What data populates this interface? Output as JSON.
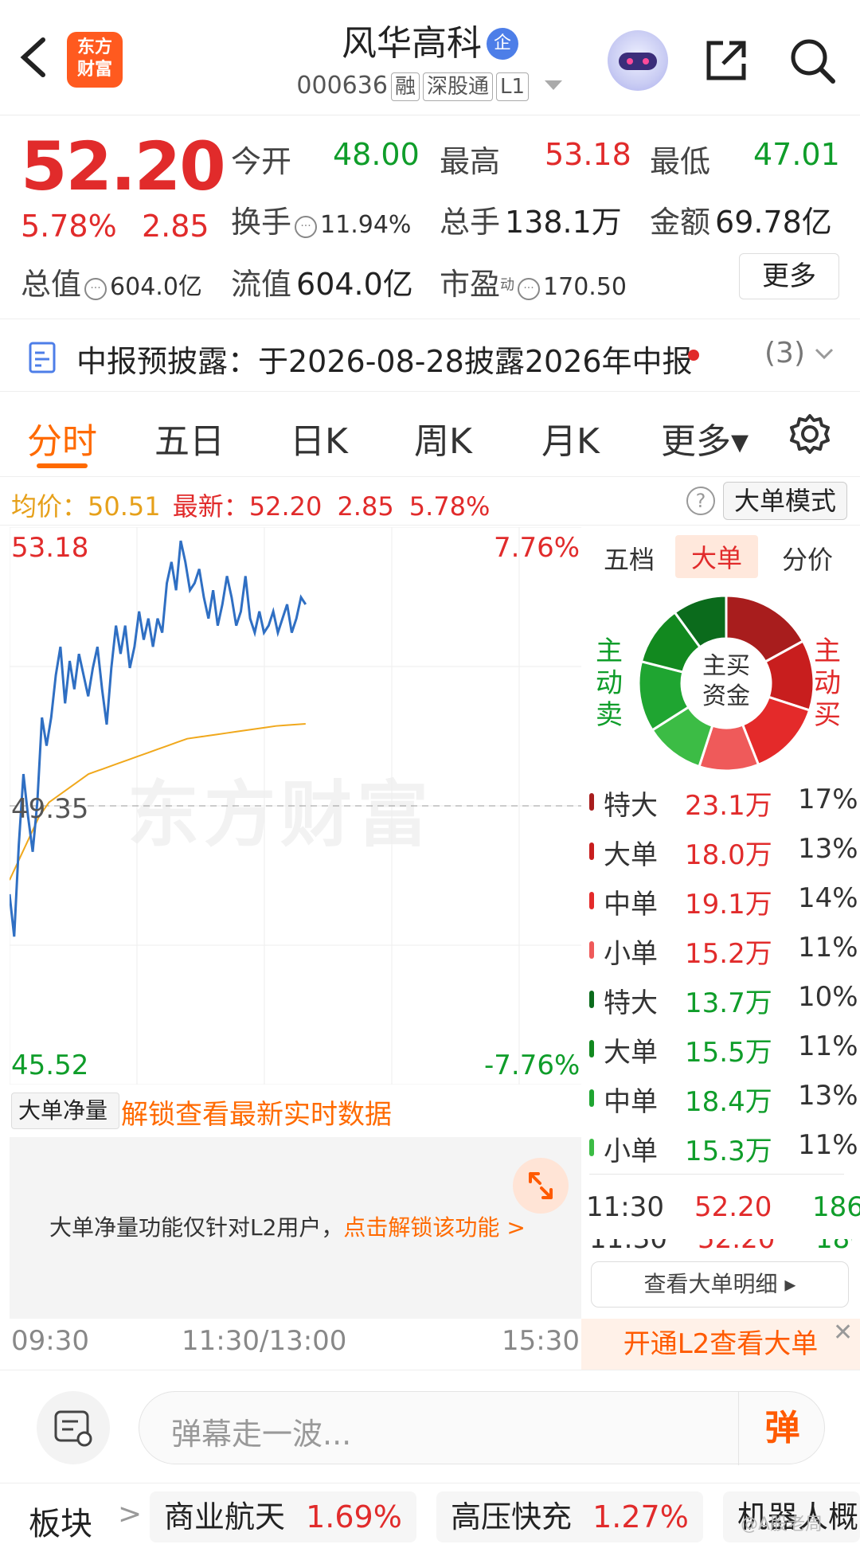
{
  "header": {
    "back_icon": "chevron-left-icon",
    "logo_line1": "东方",
    "logo_line2": "财富",
    "stock_name": "风华高科",
    "badge": "企",
    "code": "000636",
    "tags": [
      "融",
      "深股通",
      "L1"
    ]
  },
  "quote": {
    "price": "52.20",
    "pct": "5.78%",
    "change": "2.85",
    "open_label": "今开",
    "open": "48.00",
    "high_label": "最高",
    "high": "53.18",
    "low_label": "最低",
    "low": "47.01",
    "turnover_label": "换手",
    "turnover": "11.94%",
    "volume_label": "总手",
    "volume": "138.1万",
    "amount_label": "金额",
    "amount": "69.78亿",
    "mktcap_label": "总值",
    "mktcap": "604.0亿",
    "float_label": "流值",
    "float": "604.0亿",
    "pe_label": "市盈",
    "pe_sup": "动",
    "pe": "170.50",
    "more": "更多"
  },
  "disclosure": {
    "text": "中报预披露：于2026-08-28披露2026年中报",
    "count": "(3)"
  },
  "tabs": [
    "分时",
    "五日",
    "日K",
    "周K",
    "月K",
    "更多▾"
  ],
  "avg_row": {
    "avg_label": "均价：",
    "avg": "50.51",
    "latest_label": "最新：",
    "latest": "52.20",
    "chg": "2.85",
    "pct": "5.78%",
    "help": "?",
    "mode_button": "大单模式"
  },
  "chart_data": {
    "type": "line",
    "y_max_label": "53.18",
    "y_mid_label": "49.35",
    "y_min_label": "45.52",
    "pct_max_label": "7.76%",
    "pct_min_label": "-7.76%",
    "x_labels": [
      "09:30",
      "11:30/13:00",
      "15:30"
    ],
    "ylim": [
      45.52,
      53.18
    ],
    "series": [
      {
        "name": "price",
        "values": [
          48.1,
          47.5,
          48.8,
          49.8,
          49.2,
          48.7,
          49.4,
          50.6,
          50.2,
          50.6,
          51.2,
          51.6,
          50.8,
          51.4,
          51.0,
          51.5,
          51.2,
          50.9,
          51.3,
          51.6,
          51.0,
          50.5,
          51.3,
          51.9,
          51.5,
          51.9,
          51.3,
          51.6,
          52.1,
          51.7,
          52.0,
          51.6,
          52.0,
          51.8,
          52.5,
          52.8,
          52.4,
          53.1,
          52.8,
          52.4,
          52.5,
          52.7,
          52.3,
          52.0,
          52.4,
          51.9,
          52.2,
          52.6,
          52.3,
          51.9,
          52.1,
          52.6,
          52.0,
          51.8,
          52.1,
          51.8,
          51.9,
          52.1,
          51.8,
          52.0,
          52.2,
          51.8,
          52.0,
          52.3,
          52.2
        ]
      },
      {
        "name": "avg",
        "values": [
          48.3,
          48.6,
          48.9,
          49.2,
          49.4,
          49.5,
          49.6,
          49.7,
          49.8,
          49.85,
          49.9,
          49.95,
          50.0,
          50.05,
          50.1,
          50.15,
          50.2,
          50.25,
          50.3,
          50.32,
          50.34,
          50.36,
          50.38,
          50.4,
          50.42,
          50.44,
          50.46,
          50.48,
          50.49,
          50.5,
          50.51
        ]
      }
    ]
  },
  "watermark": "东方财富",
  "right_panel": {
    "tabs": [
      "五档",
      "大单",
      "分价"
    ],
    "sell_label": [
      "主",
      "动",
      "卖"
    ],
    "buy_label": [
      "主",
      "动",
      "买"
    ],
    "donut_center": [
      "主买",
      "资金"
    ],
    "buy_colors": [
      "#a81d1d",
      "#c81e1e",
      "#e42a2a",
      "#ef5a5a"
    ],
    "sell_colors": [
      "#0b6b1c",
      "#12891f",
      "#1fa531",
      "#3cbc45"
    ],
    "buy_fractions": [
      0.17,
      0.13,
      0.14,
      0.11
    ],
    "sell_fractions": [
      0.1,
      0.11,
      0.13,
      0.11
    ],
    "flows": [
      {
        "label": "特大",
        "amount": "23.1万",
        "pct": "17%",
        "side": "buy"
      },
      {
        "label": "大单",
        "amount": "18.0万",
        "pct": "13%",
        "side": "buy"
      },
      {
        "label": "中单",
        "amount": "19.1万",
        "pct": "14%",
        "side": "buy"
      },
      {
        "label": "小单",
        "amount": "15.2万",
        "pct": "11%",
        "side": "buy"
      },
      {
        "label": "特大",
        "amount": "13.7万",
        "pct": "10%",
        "side": "sell"
      },
      {
        "label": "大单",
        "amount": "15.5万",
        "pct": "11%",
        "side": "sell"
      },
      {
        "label": "中单",
        "amount": "18.4万",
        "pct": "13%",
        "side": "sell"
      },
      {
        "label": "小单",
        "amount": "15.3万",
        "pct": "11%",
        "side": "sell"
      }
    ],
    "tick": {
      "time": "11:30",
      "price": "52.20",
      "vol": "186"
    },
    "detail_button": "查看大单明细 ▸",
    "l2_banner": "开通L2查看大单",
    "l2_close": "✕"
  },
  "big_net": {
    "select": "大单净量 ▾",
    "unlock_link": "解锁查看最新实时数据",
    "box_text_pre": "大单净量功能仅针对L2用户，",
    "box_text_link": "点击解锁该功能 >"
  },
  "danmu": {
    "placeholder": "弹幕走一波...",
    "button": "弹"
  },
  "sectors": {
    "title": "板块",
    "chev": ">",
    "items": [
      {
        "name": "商业航天",
        "pct": "1.69%"
      },
      {
        "name": "高压快充",
        "pct": "1.27%"
      },
      {
        "name": "机器人概",
        "pct": ""
      }
    ]
  },
  "overlay_text": "@A股老周"
}
